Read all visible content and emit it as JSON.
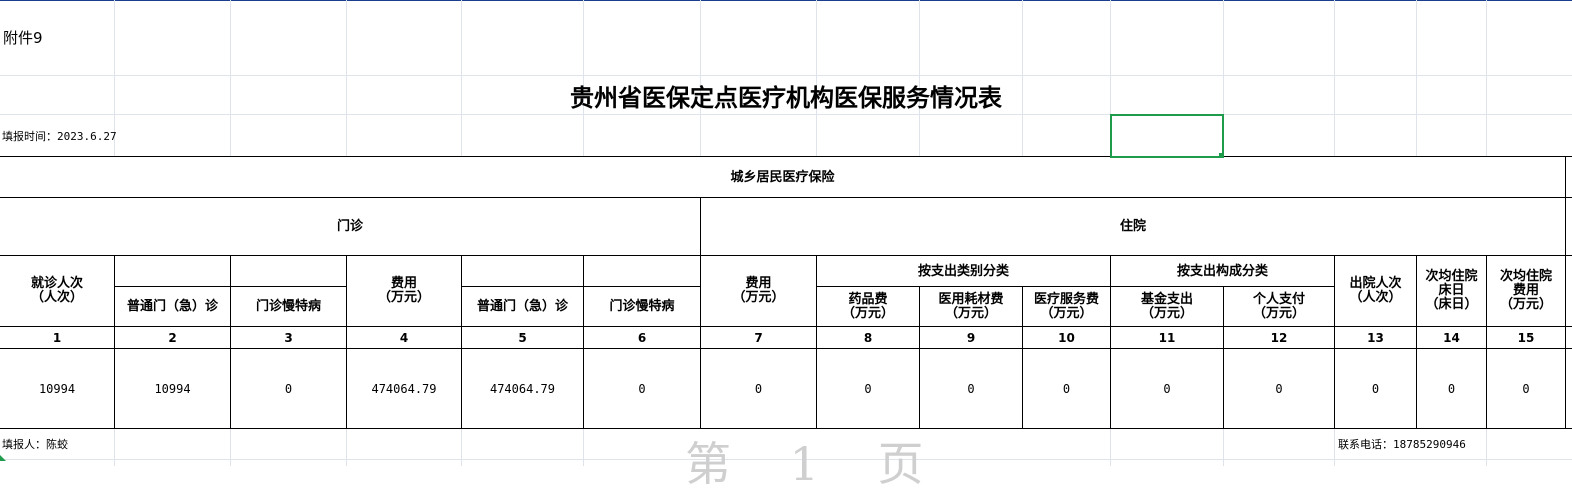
{
  "sheet": {
    "attachment_label": "附件9",
    "title": "贵州省医保定点医疗机构医保服务情况表",
    "fill_time": "填报时间：2023.6.27",
    "insurance_type": "城乡居民医疗保险",
    "outpatient": "门诊",
    "inpatient": "住院",
    "by_expense_type": "按支出类别分类",
    "by_expense_structure": "按支出构成分类",
    "headers": {
      "visits": [
        "就诊人次",
        "（人次）"
      ],
      "general_visit": "普通门（急）诊",
      "chronic_visit": "门诊慢特病",
      "cost": [
        "费用",
        "（万元）"
      ],
      "general_cost": "普通门（急）诊",
      "chronic_cost": "门诊慢特病",
      "inpatient_cost": [
        "费用",
        "（万元）"
      ],
      "drug_cost": [
        "药品费",
        "（万元）"
      ],
      "consumable_cost": [
        "医用耗材费",
        "（万元）"
      ],
      "service_cost": [
        "医疗服务费",
        "（万元）"
      ],
      "fund_payment": [
        "基金支出",
        "（万元）"
      ],
      "personal_payment": [
        "个人支付",
        "（万元）"
      ],
      "discharges": [
        "出院人次",
        "（人次）"
      ],
      "avg_bed_days": [
        "次均住院",
        "床日",
        "（床日）"
      ],
      "avg_inpatient_cost": [
        "次均住院",
        "费用",
        "（万元）"
      ]
    },
    "column_numbers": [
      "1",
      "2",
      "3",
      "4",
      "5",
      "6",
      "7",
      "8",
      "9",
      "10",
      "11",
      "12",
      "13",
      "14",
      "15"
    ],
    "values": [
      "10994",
      "10994",
      "0",
      "474064.79",
      "474064.79",
      "0",
      "0",
      "0",
      "0",
      "0",
      "0",
      "0",
      "0",
      "0",
      "0"
    ],
    "filler": "填报人：陈蛟",
    "phone": "联系电话：18785290946",
    "page_watermark": "第 1 页"
  },
  "colors": {
    "grid": "#dfe3ea",
    "selection": "#1e9b4b",
    "border": "#000000"
  }
}
